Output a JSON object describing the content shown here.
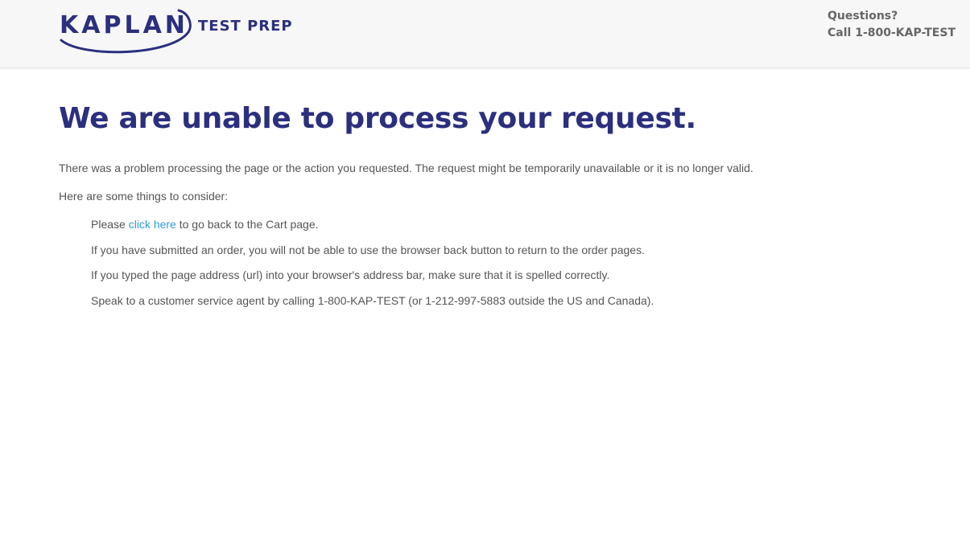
{
  "header": {
    "logo_text": "KAPLAN",
    "logo_subtext": "TEST PREP",
    "contact_line1": "Questions?",
    "contact_line2": "Call 1-800-KAP-TEST"
  },
  "main": {
    "heading": "We are unable to process your request.",
    "intro": "There was a problem processing the page or the action you requested. The request might be temporarily unavailable or it is no longer valid.",
    "consider": "Here are some things to consider:",
    "item1_prefix": "Please ",
    "item1_link": "click here",
    "item1_suffix": " to go back to the Cart page.",
    "item2": "If you have submitted an order, you will not be able to use the browser back button to return to the order pages.",
    "item3": "If you typed the page address (url) into your browser's address bar, make sure that it is spelled correctly.",
    "item4": "Speak to a customer service agent by calling 1-800-KAP-TEST (or 1-212-997-5883 outside the US and Canada)."
  },
  "colors": {
    "brand_navy": "#2b2f7e",
    "link_blue": "#2a9fd6",
    "body_text": "#555555",
    "header_bg": "#f7f7f7"
  }
}
